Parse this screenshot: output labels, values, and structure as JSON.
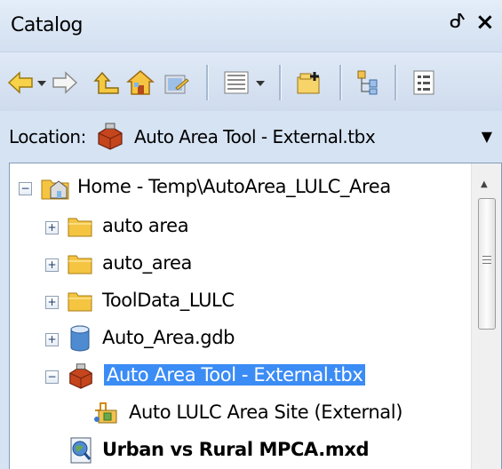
{
  "panel": {
    "title": "Catalog",
    "pin_glyph": "ᕷ",
    "close_glyph": "×"
  },
  "toolbar": {
    "icons": [
      "back-arrow-icon",
      "dropdown-icon",
      "forward-arrow-icon",
      "up-level-icon",
      "home-icon",
      "connect-folder-icon",
      "view-options-icon",
      "new-item-icon",
      "toggle-contents-icon",
      "options-icon"
    ]
  },
  "location": {
    "label": "Location:",
    "value": "Auto Area Tool - External.tbx"
  },
  "tree": {
    "items": [
      {
        "label": "Home - Temp\\AutoArea_LULC_Area",
        "icon": "home-folder-icon",
        "expander": "−"
      },
      {
        "label": "auto area",
        "icon": "folder-icon",
        "expander": "+"
      },
      {
        "label": "auto_area",
        "icon": "folder-icon",
        "expander": "+"
      },
      {
        "label": "ToolData_LULC",
        "icon": "folder-icon",
        "expander": "+"
      },
      {
        "label": "Auto_Area.gdb",
        "icon": "geodatabase-icon",
        "expander": "+"
      },
      {
        "label": "Auto Area Tool - External.tbx",
        "icon": "toolbox-icon",
        "expander": "−",
        "selected": true
      },
      {
        "label": "Auto LULC Area Site (External)",
        "icon": "model-tool-icon"
      },
      {
        "label": "Urban vs Rural MPCA.mxd",
        "icon": "map-document-icon",
        "bold": true
      }
    ]
  },
  "colors": {
    "selection": "#3b8cf5",
    "panel_bg": "#d6e3f3",
    "folder": "#f5c542"
  }
}
